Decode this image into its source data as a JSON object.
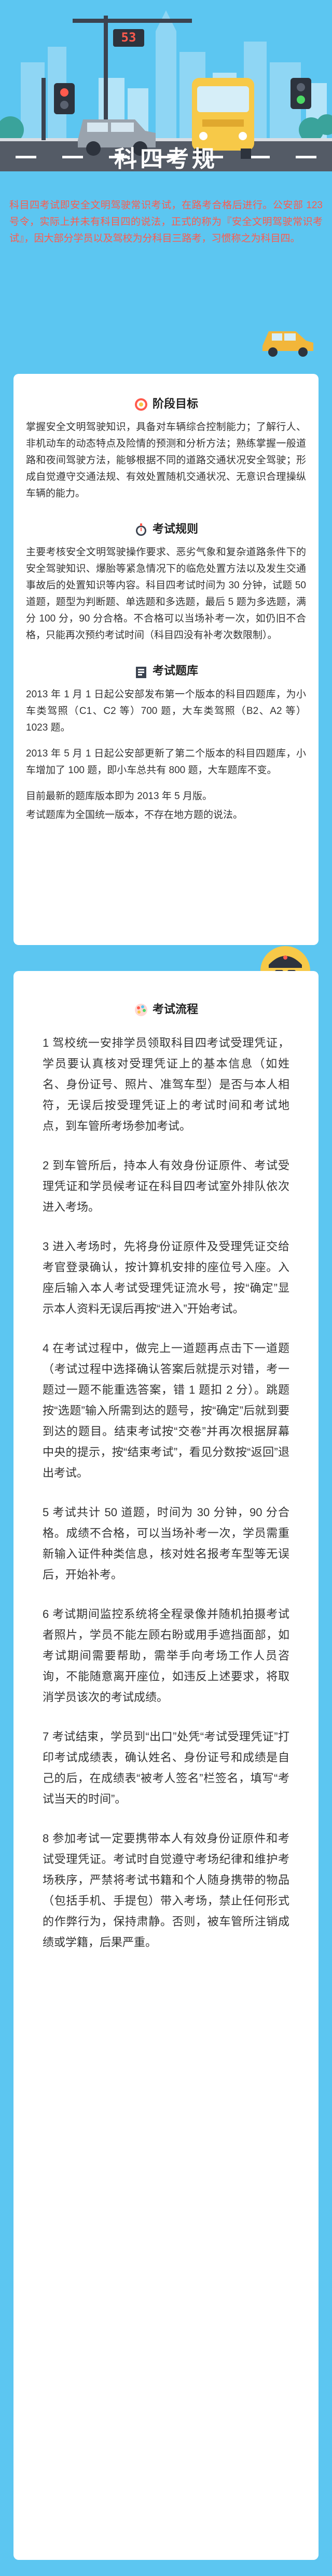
{
  "hero": {
    "signal_number": "53"
  },
  "title": "科四考规",
  "intro": "科目四考试即安全文明驾驶常识考试，在路考合格后进行。公安部 123 号令，实际上并未有科目四的说法，正式的称为『安全文明驾驶常识考试』，因大部分学员以及驾校为分科目三路考，习惯称之为科目四。",
  "sections": {
    "goal": {
      "heading": "阶段目标",
      "body": "掌握安全文明驾驶知识，具备对车辆综合控制能力；了解行人、非机动车的动态特点及险情的预测和分析方法；熟练掌握一般道路和夜间驾驶方法，能够根据不同的道路交通状况安全驾驶；形成自觉遵守交通法规、有效处置随机交通状况、无意识合理操纵车辆的能力。"
    },
    "rules": {
      "heading": "考试规则",
      "body": "主要考核安全文明驾驶操作要求、恶劣气象和复杂道路条件下的安全驾驶知识、爆胎等紧急情况下的临危处置方法以及发生交通事故后的处置知识等内容。科目四考试时间为 30 分钟，试题 50 道题，题型为判断题、单选题和多选题，最后 5 题为多选题，满分 100 分，90 分合格。不合格可以当场补考一次，如仍旧不合格，只能再次预约考试时间（科目四没有补考次数限制）。"
    },
    "bank": {
      "heading": "考试题库",
      "paras": [
        "2013 年 1 月 1 日起公安部发布第一个版本的科目四题库，为小车类驾照（C1、C2 等）700 题，大车类驾照（B2、A2 等）1023 题。",
        "2013 年 5 月 1 日起公安部更新了第二个版本的科目四题库，小车增加了 100 题，即小车总共有 800 题，大车题库不变。",
        "目前最新的题库版本即为 2013 年 5 月版。",
        "考试题库为全国统一版本，不存在地方题的说法。"
      ]
    },
    "flow": {
      "heading": "考试流程",
      "paras": [
        "1 驾校统一安排学员领取科目四考试受理凭证，学员要认真核对受理凭证上的基本信息（如姓名、身份证号、照片、准驾车型）是否与本人相符，无误后按受理凭证上的考试时间和考试地点，到车管所考场参加考试。",
        "2 到车管所后，持本人有效身份证原件、考试受理凭证和学员候考证在科目四考试室外排队依次进入考场。",
        "3 进入考场时，先将身份证原件及受理凭证交给考官登录确认，按计算机安排的座位号入座。入座后输入本人考试受理凭证流水号，按“确定”显示本人资料无误后再按“进入”开始考试。",
        "4 在考试过程中，做完上一道题再点击下一道题（考试过程中选择确认答案后就提示对错，考一题过一题不能重选答案，错 1 题扣 2 分）。跳题按“选题”输入所需到达的题号，按“确定”后就到要到达的题目。结束考试按“交卷”并再次根据屏幕中央的提示，按“结束考试”，看见分数按“返回”退出考试。",
        "5 考试共计 50 道题，时间为 30 分钟，90 分合格。成绩不合格，可以当场补考一次，学员需重新输入证件种类信息，核对姓名报考车型等无误后，开始补考。",
        "6 考试期间监控系统将全程录像并随机拍摄考试者照片，学员不能左顾右盼或用手遮挡面部，如考试期间需要帮助，需举手向考场工作人员咨询，不能随意离开座位，如违反上述要求，将取消学员该次的考试成绩。",
        "7 考试结束，学员到“出口”处凭“考试受理凭证”打印考试成绩表，确认姓名、身份证号和成绩是自己的后，在成绩表“被考人签名”栏签名，填写“考试当天的时间”。",
        "8 参加考试一定要携带本人有效身份证原件和考试受理凭证。考试时自觉遵守考场纪律和维护考场秩序，严禁将考试书籍和个人随身携带的物品（包括手机、手提包）带入考场，禁止任何形式的作弊行为，保持肃静。否则，被车管所注销成绩或学籍，后果严重。"
      ]
    }
  },
  "colors": {
    "sky": "#5cc6f1",
    "intro_text": "#ff5a4d",
    "card": "#ffffff",
    "road": "#545b66",
    "bus": "#f7c948",
    "car": "#f2b63a"
  },
  "icons": {
    "goal": "target-icon",
    "rules": "stopwatch-icon",
    "bank": "book-icon",
    "flow": "palette-icon"
  }
}
